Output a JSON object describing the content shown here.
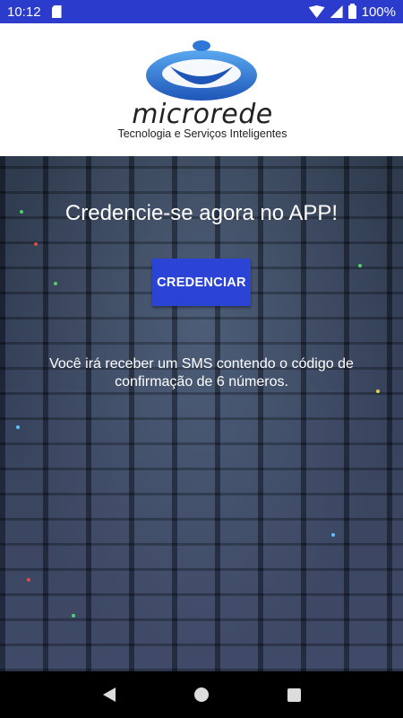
{
  "status_bar": {
    "time": "10:12",
    "battery": "100%",
    "icons": [
      "sd-card-icon",
      "wifi-icon",
      "signal-icon",
      "battery-icon"
    ]
  },
  "header": {
    "brand_name": "microrede",
    "tagline": "Tecnologia e Serviços Inteligentes"
  },
  "main": {
    "title": "Credencie-se agora no APP!",
    "button_label": "CREDENCIAR",
    "info": "Você irá receber um SMS contendo o código de confirmação de 6 números."
  },
  "nav": {
    "icons": [
      "back-icon",
      "home-icon",
      "recents-icon"
    ]
  },
  "colors": {
    "status_bar": "#2b3bcc",
    "button": "#2b44d6",
    "logo_blue": "#2f77d6"
  }
}
